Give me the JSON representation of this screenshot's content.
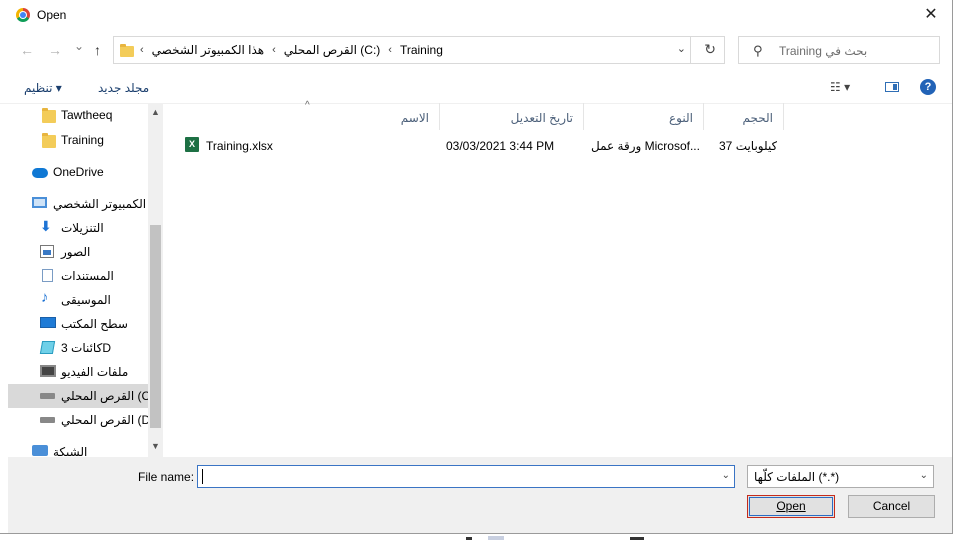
{
  "window": {
    "title": "Open",
    "close_glyph": "✕"
  },
  "nav": {
    "back_glyph": "←",
    "forward_glyph": "→",
    "recent_glyph": "⌄",
    "up_glyph": "↑",
    "breadcrumb": [
      "هذا الكمبيوتر الشخصي",
      "القرص المحلي (C:)",
      "Training"
    ],
    "separator": "‹",
    "search_placeholder": "Training بحث في"
  },
  "toolbar": {
    "organize_label": "تنظيم ▾",
    "new_folder_label": "مجلد جديد",
    "views_glyph": "☷ ▾",
    "help_label": "?"
  },
  "sidebar": {
    "items": [
      {
        "label": "Tawtheeq",
        "icon": "folder-icon"
      },
      {
        "label": "Training",
        "icon": "folder-icon"
      },
      {
        "label": "OneDrive",
        "icon": "cloud-icon"
      },
      {
        "label": "ا الكمبيوتر الشخصي",
        "icon": "computer-icon"
      },
      {
        "label": "التنزيلات",
        "icon": "download-icon"
      },
      {
        "label": "الصور",
        "icon": "pictures-icon"
      },
      {
        "label": "المستندات",
        "icon": "documents-icon"
      },
      {
        "label": "الموسيقى",
        "icon": "music-icon"
      },
      {
        "label": "سطح المكتب",
        "icon": "desktop-icon"
      },
      {
        "label": "كائنات 3D",
        "icon": "3d-objects-icon"
      },
      {
        "label": "ملفات الفيديو",
        "icon": "videos-icon"
      },
      {
        "label": "القرص المحلي (C:",
        "icon": "drive-icon",
        "selected": true
      },
      {
        "label": "القرص المحلي (D:",
        "icon": "drive-icon"
      },
      {
        "label": "الشبكة",
        "icon": "network-icon"
      }
    ],
    "glyph_music": "♪",
    "glyph_download": "⬇",
    "scroll_up_glyph": "▲",
    "scroll_down_glyph": "▼"
  },
  "columns": {
    "name": "الاسم",
    "date": "تاريخ التعديل",
    "type": "النوع",
    "size": "الحجم",
    "sort_glyph": "^"
  },
  "files": [
    {
      "name": "Training.xlsx",
      "date": "03/03/2021 3:44 PM",
      "type": "ورقة عمل Microsof...",
      "size": "37 كيلوبايت",
      "icon": "excel-file-icon",
      "icon_letter": "X"
    }
  ],
  "footer": {
    "file_name_label": "File name:",
    "file_name_value": "",
    "file_type_value": "الملفات كلّها (*.*)",
    "dropdown_glyph": "⌄",
    "open_label": "Open",
    "cancel_label": "Cancel"
  },
  "colors": {
    "accent": "#2b6cc4",
    "selection": "#d9d9d9",
    "excel_green": "#1d7044",
    "folder_yellow": "#f3cc59"
  }
}
